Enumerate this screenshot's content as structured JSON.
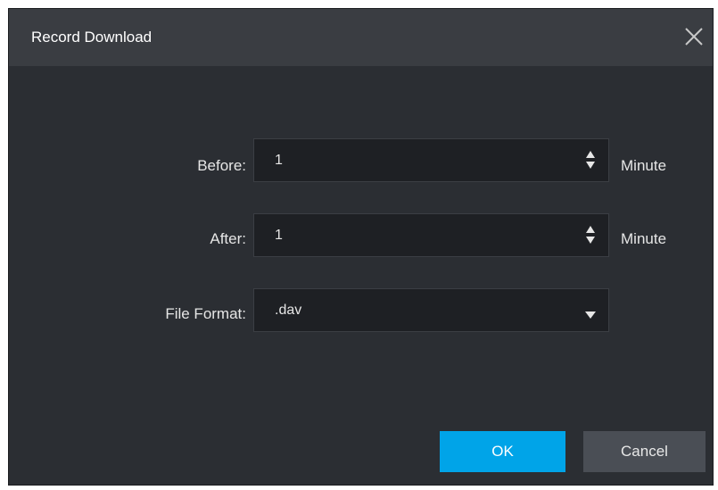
{
  "dialog": {
    "title": "Record Download",
    "close_icon": "close-icon"
  },
  "form": {
    "before": {
      "label": "Before:",
      "value": "1",
      "unit": "Minute"
    },
    "after": {
      "label": "After:",
      "value": "1",
      "unit": "Minute"
    },
    "file_format": {
      "label": "File Format:",
      "selected": ".dav"
    }
  },
  "buttons": {
    "ok": "OK",
    "cancel": "Cancel"
  },
  "colors": {
    "dialog_bg": "#2b2e33",
    "titlebar_bg": "#3a3d42",
    "accent": "#00a4e8",
    "secondary_button": "#4a4e55"
  }
}
